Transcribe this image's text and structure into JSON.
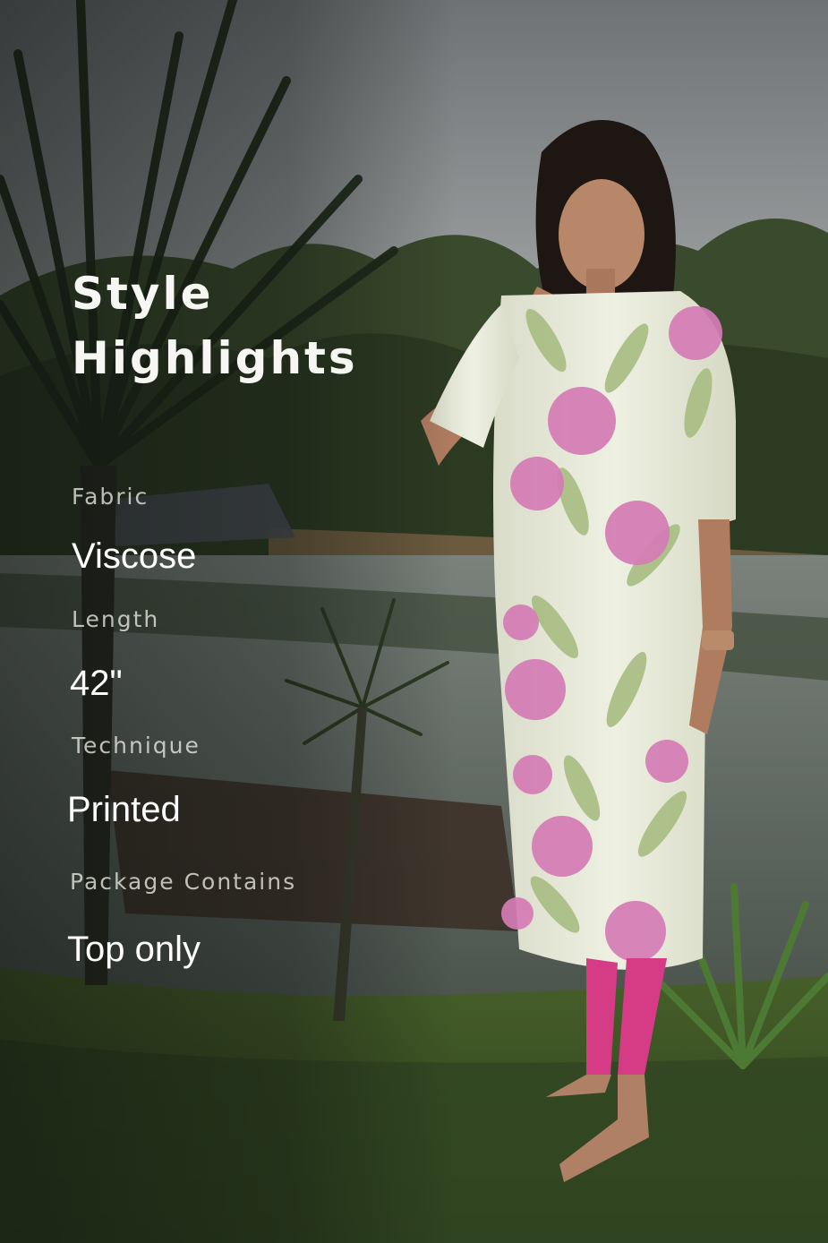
{
  "heading": {
    "line1": "Style",
    "line2": "Highlights"
  },
  "specs": [
    {
      "label": "Fabric",
      "value": "Viscose"
    },
    {
      "label": "Length",
      "value": "42\""
    },
    {
      "label": "Technique",
      "value": "Printed"
    },
    {
      "label": "Package Contains",
      "value": "Top only"
    }
  ],
  "colors": {
    "sky": "#9a9d9e",
    "foliage": "#2f3a26",
    "grass": "#4a6a2c",
    "water": "#5f6762",
    "kurta": "#e6e8d8",
    "print_pink": "#d57cb5",
    "print_green": "#a9bd82",
    "leggings": "#d63b86",
    "text_primary": "#ffffff"
  }
}
